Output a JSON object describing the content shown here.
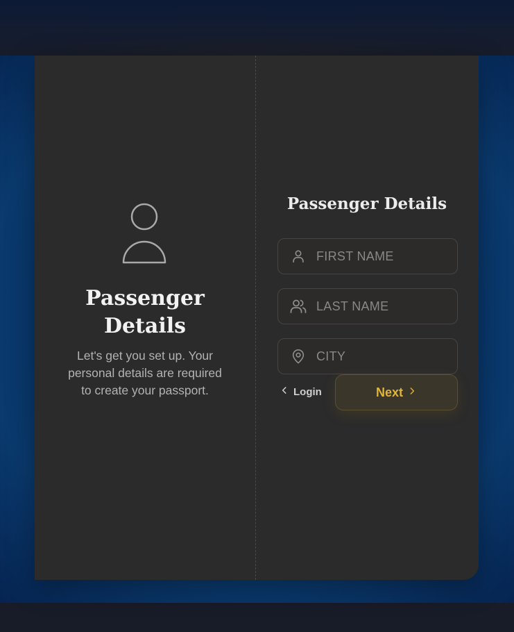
{
  "left": {
    "title_line1": "Passenger",
    "title_line2": "Details",
    "description": "Let's get you set up. Your personal details are required to create your passport.",
    "icon": "person-icon"
  },
  "form": {
    "title": "Passenger Details",
    "fields": [
      {
        "name": "first-name",
        "placeholder": "FIRST NAME",
        "value": "",
        "icon": "user-icon"
      },
      {
        "name": "last-name",
        "placeholder": "LAST NAME",
        "value": "",
        "icon": "users-icon"
      },
      {
        "name": "city",
        "placeholder": "CITY",
        "value": "",
        "icon": "map-pin-icon"
      }
    ],
    "login_label": "Login",
    "next_label": "Next"
  },
  "colors": {
    "card": "#2b2b2b",
    "accent": "#e1b43a",
    "background": "#07356a"
  }
}
